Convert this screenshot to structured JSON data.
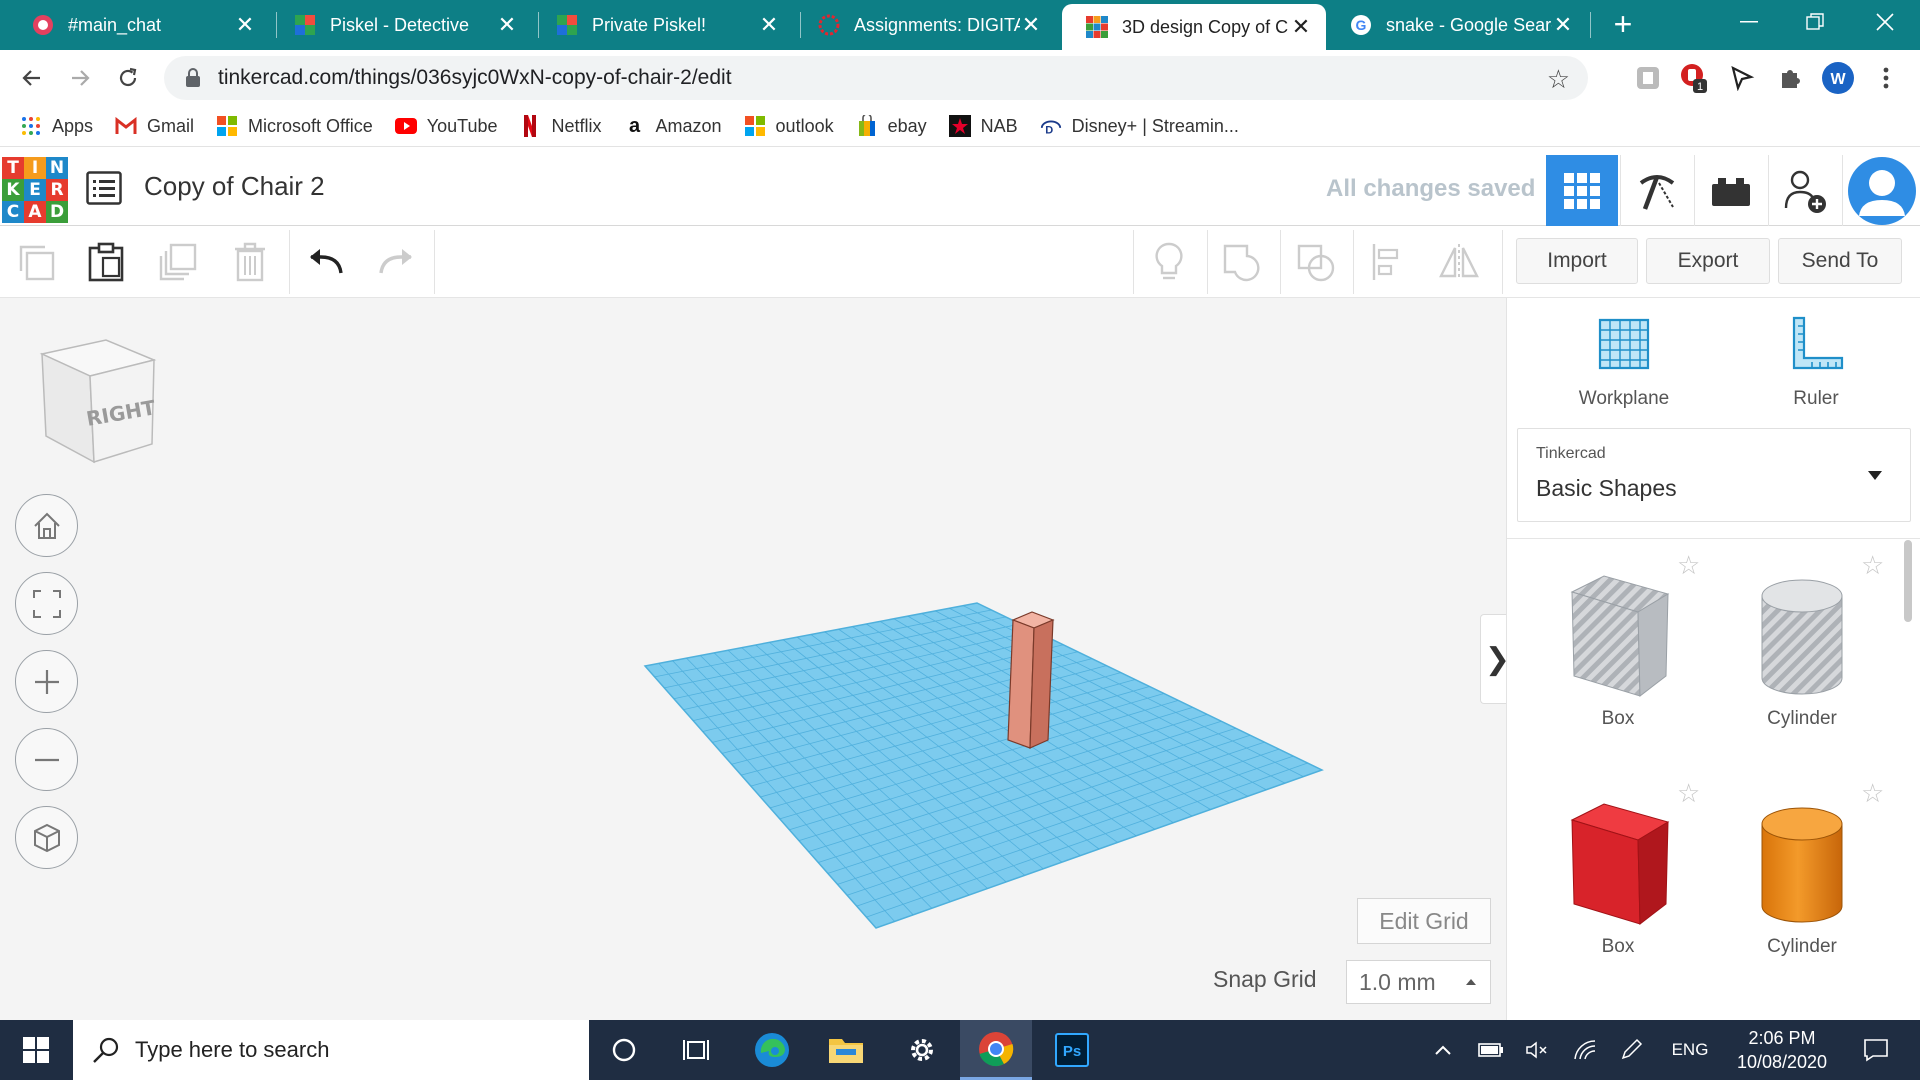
{
  "browser": {
    "tabs": [
      {
        "title": "#main_chat",
        "icon": "discord-icon"
      },
      {
        "title": "Piskel - Detective",
        "icon": "piskel-icon"
      },
      {
        "title": "Private Piskel!",
        "icon": "piskel-icon"
      },
      {
        "title": "Assignments: DIGITA",
        "icon": "canvas-icon"
      },
      {
        "title": "3D design Copy of C",
        "icon": "tinkercad-icon",
        "active": true
      },
      {
        "title": "snake - Google Searc",
        "icon": "google-icon"
      }
    ],
    "url": "tinkercad.com/things/036syjc0WxN-copy-of-chair-2/edit",
    "extension_badge": "1",
    "profile_initial": "W",
    "bookmarks": [
      {
        "label": "Apps"
      },
      {
        "label": "Gmail"
      },
      {
        "label": "Microsoft Office"
      },
      {
        "label": "YouTube"
      },
      {
        "label": "Netflix"
      },
      {
        "label": "Amazon"
      },
      {
        "label": "outlook"
      },
      {
        "label": "ebay"
      },
      {
        "label": "NAB"
      },
      {
        "label": "Disney+ | Streamin..."
      }
    ]
  },
  "tinkercad": {
    "logo_letters": [
      "T",
      "I",
      "N",
      "K",
      "E",
      "R",
      "C",
      "A",
      "D"
    ],
    "design_title": "Copy of Chair 2",
    "saved_status": "All changes saved",
    "buttons": {
      "import": "Import",
      "export": "Export",
      "send_to": "Send To"
    },
    "view_cube_label": "RIGHT",
    "edit_grid": "Edit Grid",
    "snap_grid_label": "Snap Grid",
    "snap_grid_value": "1.0 mm",
    "side_tools": {
      "workplane": "Workplane",
      "ruler": "Ruler"
    },
    "library": {
      "category": "Tinkercad",
      "name": "Basic Shapes"
    },
    "shapes": [
      {
        "label": "Box",
        "style": "hole"
      },
      {
        "label": "Cylinder",
        "style": "hole"
      },
      {
        "label": "Box",
        "style": "solid"
      },
      {
        "label": "Cylinder",
        "style": "solid"
      }
    ],
    "colors": {
      "workplane": "#6cc3eb",
      "grid_line": "#3da2d4",
      "pillar": "#e0917e",
      "box_red": "#d8232a",
      "cylinder_orange": "#ef8b12",
      "accent": "#2f8de4"
    }
  },
  "taskbar": {
    "search_placeholder": "Type here to search",
    "language": "ENG",
    "time": "2:06 PM",
    "date": "10/08/2020"
  }
}
